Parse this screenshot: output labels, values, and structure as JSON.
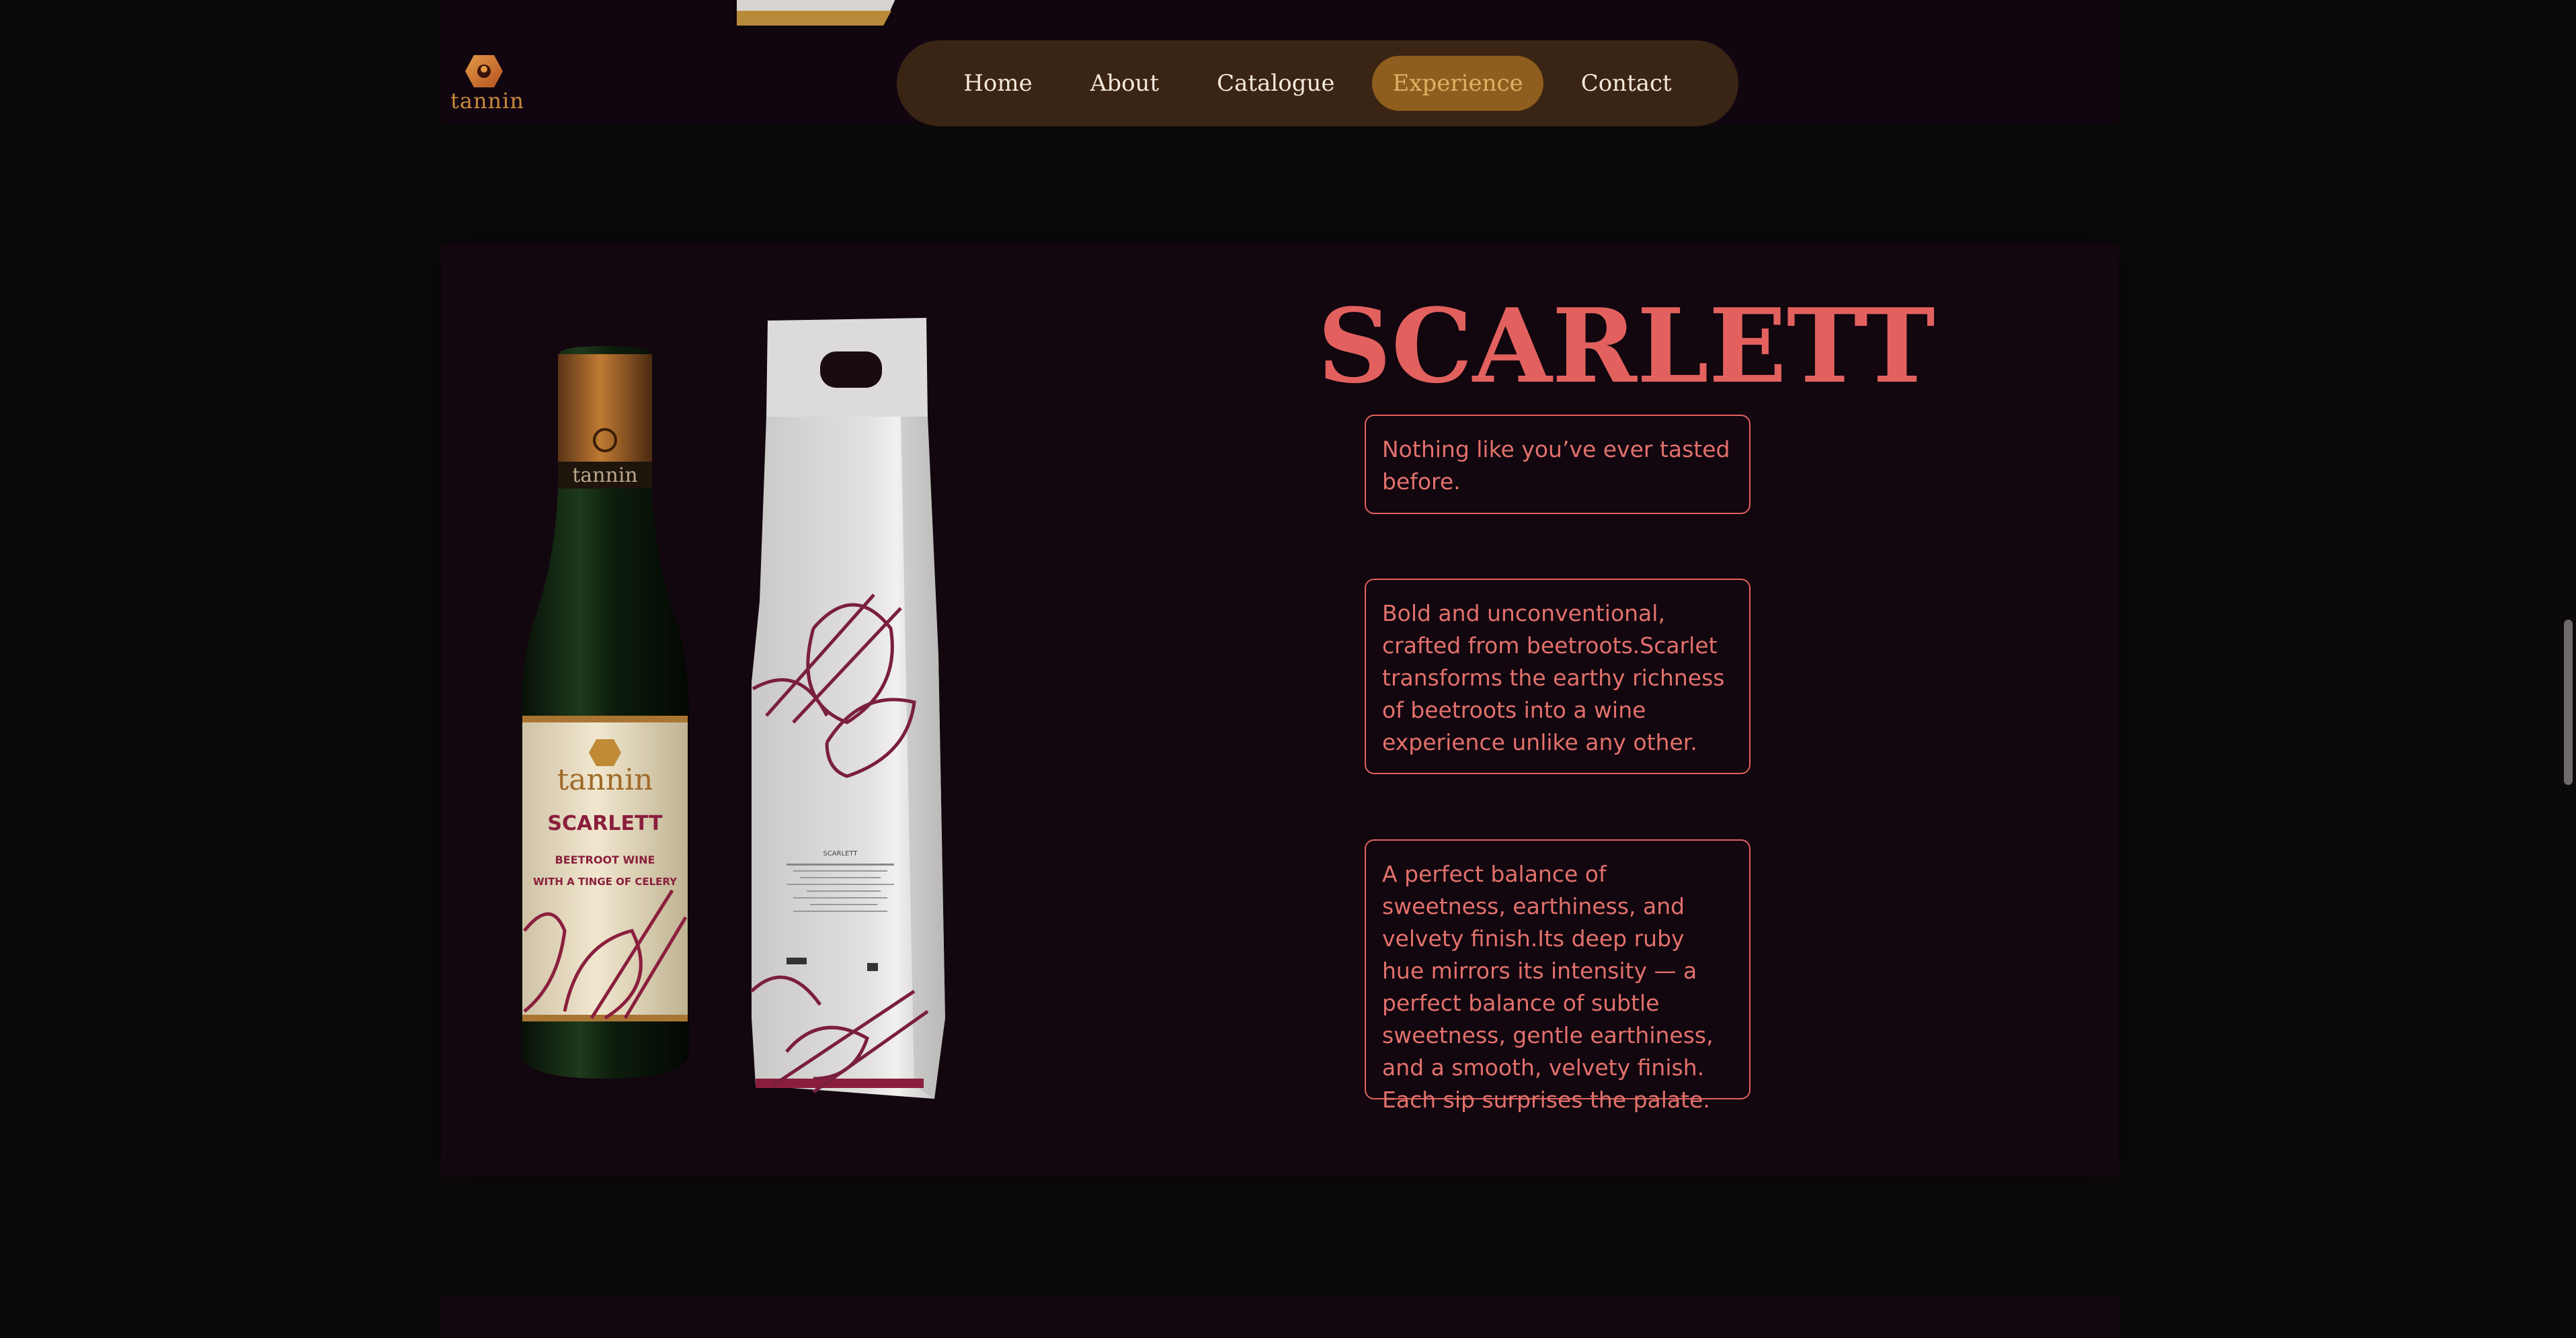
{
  "brand": {
    "logo_text": "tannin"
  },
  "nav": {
    "items": [
      {
        "label": "Home"
      },
      {
        "label": "About"
      },
      {
        "label": "Catalogue"
      },
      {
        "label": "Experience",
        "active": true
      },
      {
        "label": "Contact"
      }
    ]
  },
  "product": {
    "title": "SCARLETT",
    "descriptions": [
      "Nothing like you’ve ever tasted before.",
      "Bold and unconventional, crafted from beetroots.Scarlet transforms the earthy richness of beetroots into a wine experience unlike any other.",
      "A perfect balance of sweetness, earthiness, and velvety finish.Its deep ruby hue mirrors its intensity — a perfect balance of subtle sweetness, gentle earthiness, and a smooth, velvety finish. Each sip surprises the palate."
    ],
    "bottle_label": {
      "brand": "tannin",
      "neck_brand": "tannin",
      "name": "SCARLETT",
      "line1": "BEETROOT WINE",
      "line2": "WITH A TINGE OF CELERY"
    },
    "box_label": {
      "name": "SCARLETT"
    }
  },
  "colors": {
    "accent": "#e2615e",
    "nav_bg": "#3a2414",
    "nav_active": "#8f5d1e",
    "gold": "#c9893b",
    "panel_bg": "#12060f"
  }
}
